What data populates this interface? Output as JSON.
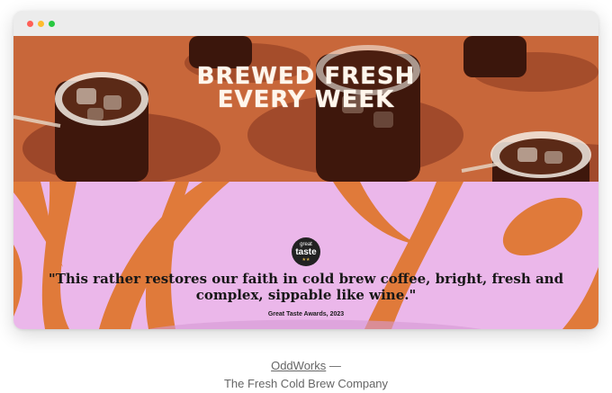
{
  "hero": {
    "title_line1": "BREWED FRESH",
    "title_line2": "EVERY WEEK"
  },
  "quote": {
    "badge": {
      "top": "great",
      "main": "taste",
      "stars": "★★"
    },
    "text": "\"This rather restores our faith in cold brew coffee, bright, fresh and complex, sippable like wine.\"",
    "source": "Great Taste Awards, 2023"
  },
  "caption": {
    "link": "OddWorks",
    "dash": " —",
    "subtitle": "The Fresh Cold Brew Company"
  },
  "colors": {
    "hero_bg": "#c8673a",
    "quote_bg": "#ebb7ea",
    "accent_orange": "#e07a3a"
  }
}
